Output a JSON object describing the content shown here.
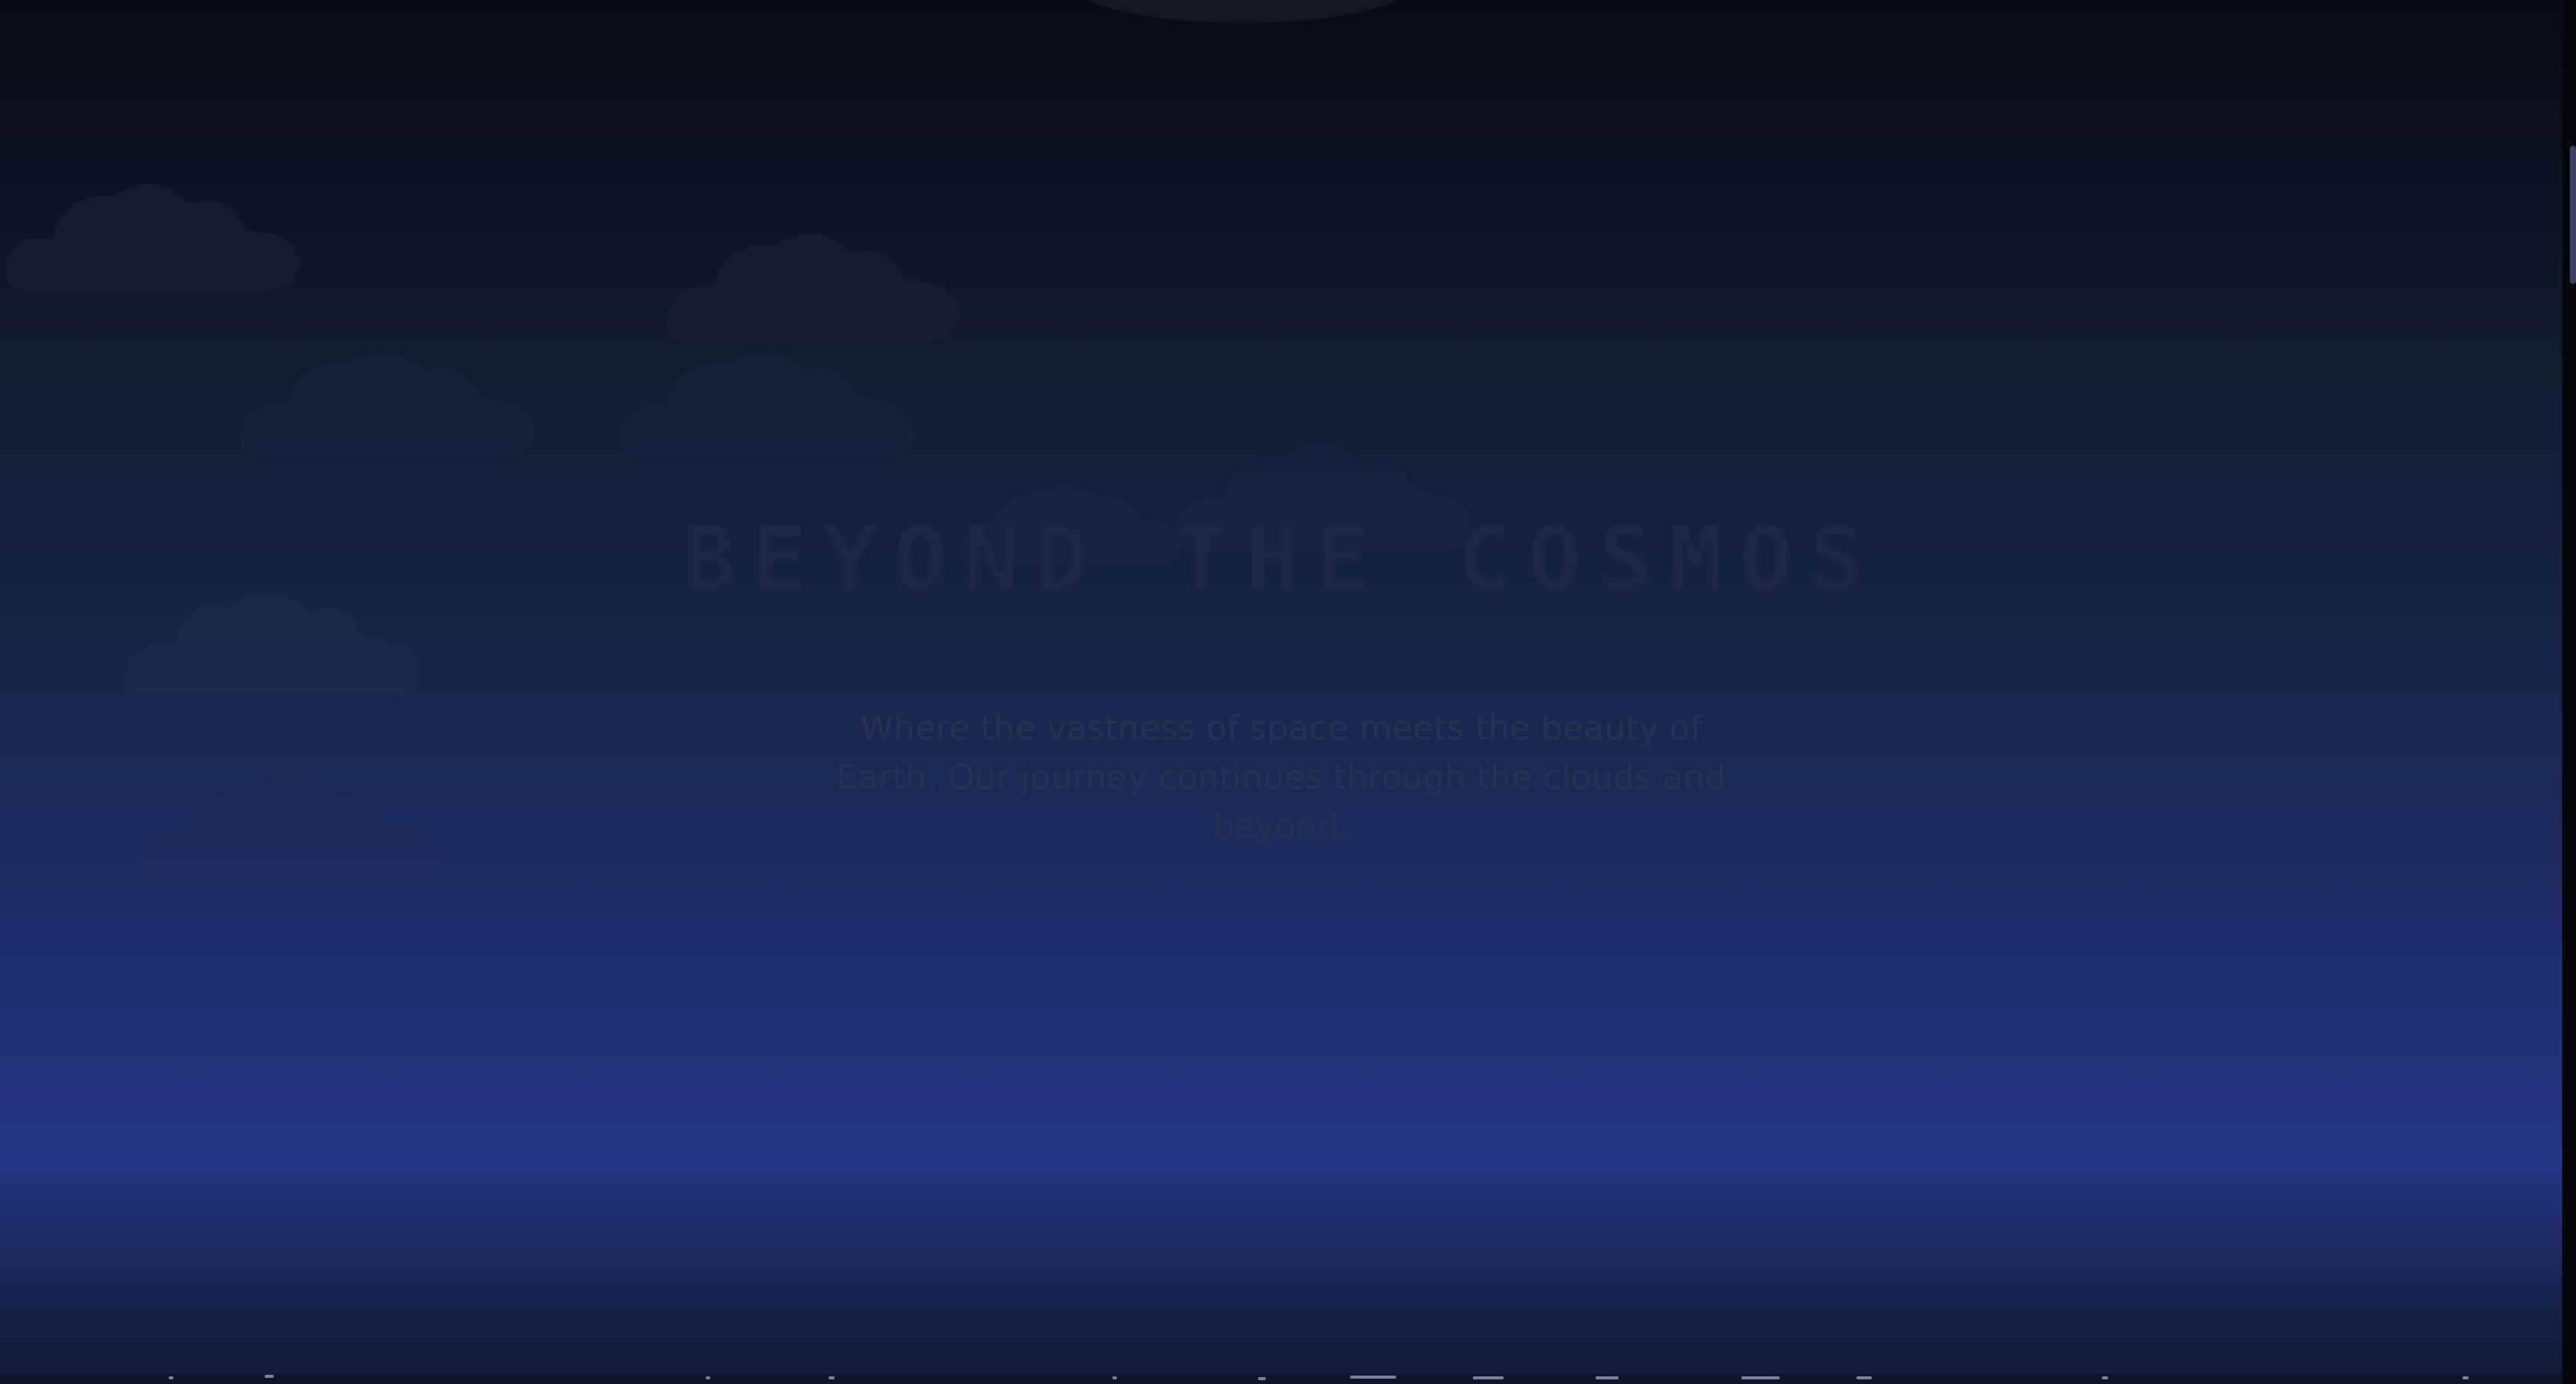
{
  "hero": {
    "title": "BEYOND THE COSMOS",
    "subtitle": "Where the vastness of space meets the beauty of Earth. Our journey continues through the clouds and beyond."
  },
  "colors": {
    "sky_top": "#070a10",
    "sky_mid": "#1a2751",
    "sky_horizon": "#233482",
    "cloud": "#1e2438"
  },
  "icons": {
    "cloud": "cloud-icon"
  }
}
